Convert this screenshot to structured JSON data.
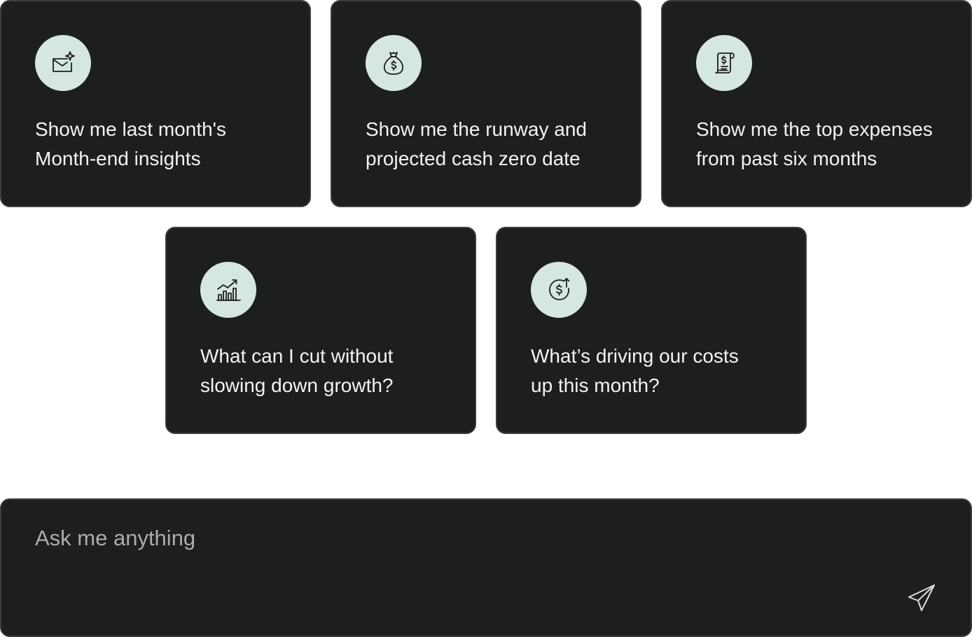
{
  "suggestions": [
    {
      "icon": "mail-sparkle-icon",
      "text": "Show me last month's Month-end insights"
    },
    {
      "icon": "money-bag-icon",
      "text": "Show me the runway and projected cash zero date"
    },
    {
      "icon": "receipt-dollar-icon",
      "text": "Show me the top expenses from past six months"
    },
    {
      "icon": "growth-chart-icon",
      "text": "What can I cut without slowing down growth?"
    },
    {
      "icon": "dollar-up-icon",
      "text": "What’s driving our costs up this month?"
    }
  ],
  "chat": {
    "placeholder": "Ask me anything",
    "send_icon": "send-icon"
  },
  "colors": {
    "card_bg": "#1d1f1f",
    "icon_circle_bg": "#d6e6e2",
    "text": "#f2f4f4",
    "placeholder": "#a9adad"
  }
}
